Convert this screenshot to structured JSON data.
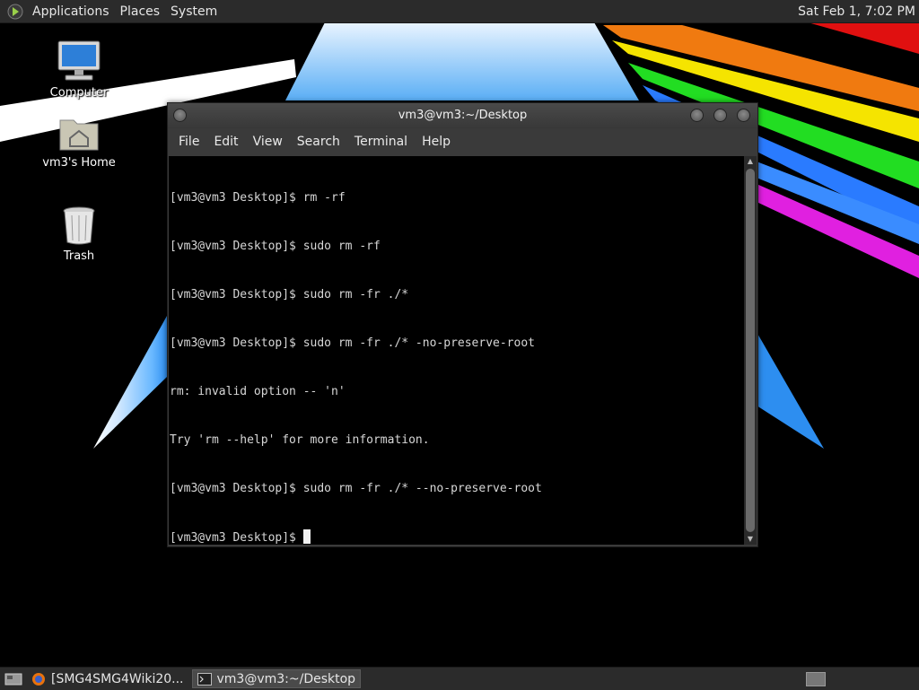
{
  "top_panel": {
    "menus": [
      "Applications",
      "Places",
      "System"
    ],
    "clock": "Sat Feb  1,  7:02 PM"
  },
  "desktop": {
    "icons": [
      {
        "label": "Computer",
        "icon": "computer-icon"
      },
      {
        "label": "vm3's Home",
        "icon": "home-folder-icon"
      },
      {
        "label": "Trash",
        "icon": "trash-icon"
      }
    ]
  },
  "terminal": {
    "title": "vm3@vm3:~/Desktop",
    "menu": [
      "File",
      "Edit",
      "View",
      "Search",
      "Terminal",
      "Help"
    ],
    "lines": [
      "[vm3@vm3 Desktop]$ rm -rf",
      "[vm3@vm3 Desktop]$ sudo rm -rf",
      "[vm3@vm3 Desktop]$ sudo rm -fr ./*",
      "[vm3@vm3 Desktop]$ sudo rm -fr ./* -no-preserve-root",
      "rm: invalid option -- 'n'",
      "Try 'rm --help' for more information.",
      "[vm3@vm3 Desktop]$ sudo rm -fr ./* --no-preserve-root",
      "[vm3@vm3 Desktop]$ "
    ]
  },
  "taskbar": {
    "tasks": [
      {
        "label": "[SMG4SMG4Wiki20...",
        "icon": "firefox-icon",
        "active": false
      },
      {
        "label": "vm3@vm3:~/Desktop",
        "icon": "terminal-icon",
        "active": true
      }
    ]
  },
  "colors": {
    "panel_bg": "#2b2b2b",
    "terminal_bg": "#000000",
    "terminal_fg": "#d7d7d7"
  }
}
